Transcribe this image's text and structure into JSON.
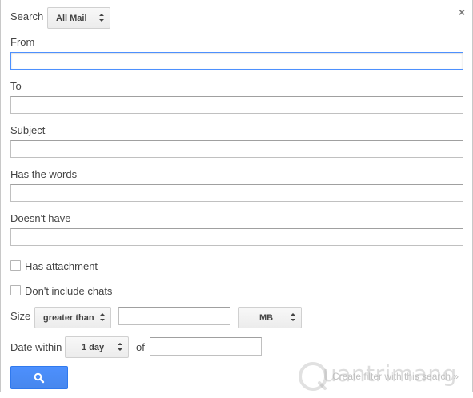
{
  "dialog": {
    "close_label": "×"
  },
  "search_scope": {
    "label": "Search",
    "selected": "All Mail"
  },
  "fields": {
    "from_label": "From",
    "from_value": "",
    "to_label": "To",
    "to_value": "",
    "subject_label": "Subject",
    "subject_value": "",
    "has_words_label": "Has the words",
    "has_words_value": "",
    "doesnt_have_label": "Doesn't have",
    "doesnt_have_value": ""
  },
  "options": {
    "has_attachment_label": "Has attachment",
    "has_attachment_checked": false,
    "dont_include_chats_label": "Don't include chats",
    "dont_include_chats_checked": false
  },
  "size": {
    "label": "Size",
    "comparator": "greater than",
    "value": "",
    "unit": "MB"
  },
  "date_within": {
    "label": "Date within",
    "range": "1 day",
    "of_label": "of",
    "value": ""
  },
  "actions": {
    "search_icon": "search-icon",
    "create_filter_label": "Create filter with this search »"
  },
  "watermark": {
    "text": "uantrimang"
  },
  "colors": {
    "primary_blue": "#4d90fe",
    "focus_border": "#4d90fe"
  }
}
